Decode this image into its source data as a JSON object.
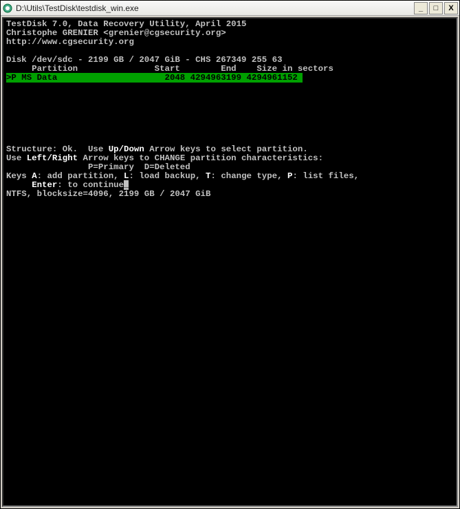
{
  "window": {
    "title": "D:\\Utils\\TestDisk\\testdisk_win.exe"
  },
  "header": {
    "line1": "TestDisk 7.0, Data Recovery Utility, April 2015",
    "line2": "Christophe GRENIER <grenier@cgsecurity.org>",
    "line3": "http://www.cgsecurity.org"
  },
  "disk": {
    "info": "Disk /dev/sdc - 2199 GB / 2047 GiB - CHS 267349 255 63",
    "columns": "     Partition               Start        End    Size in sectors"
  },
  "partition": {
    "row": ">P MS Data                     2048 4294963199 4294961152 "
  },
  "footer": {
    "struct_pre": "Structure: Ok.  Use ",
    "struct_bold": "Up/Down",
    "struct_post": " Arrow keys to select partition.",
    "lr_pre": "Use ",
    "lr_bold": "Left/Right",
    "lr_post": " Arrow keys to CHANGE partition characteristics:",
    "legend": "                P=Primary  D=Deleted",
    "keys_pre": "Keys ",
    "k_a": "A",
    "k_a_post": ": add partition, ",
    "k_l": "L",
    "k_l_post": ": load backup, ",
    "k_t": "T",
    "k_t_post": ": change type, ",
    "k_p": "P",
    "k_p_post": ": list files,",
    "enter_pre": "     ",
    "enter": "Enter",
    "enter_post": ": to continue",
    "fs": "NTFS, blocksize=4096, 2199 GB / 2047 GiB"
  }
}
